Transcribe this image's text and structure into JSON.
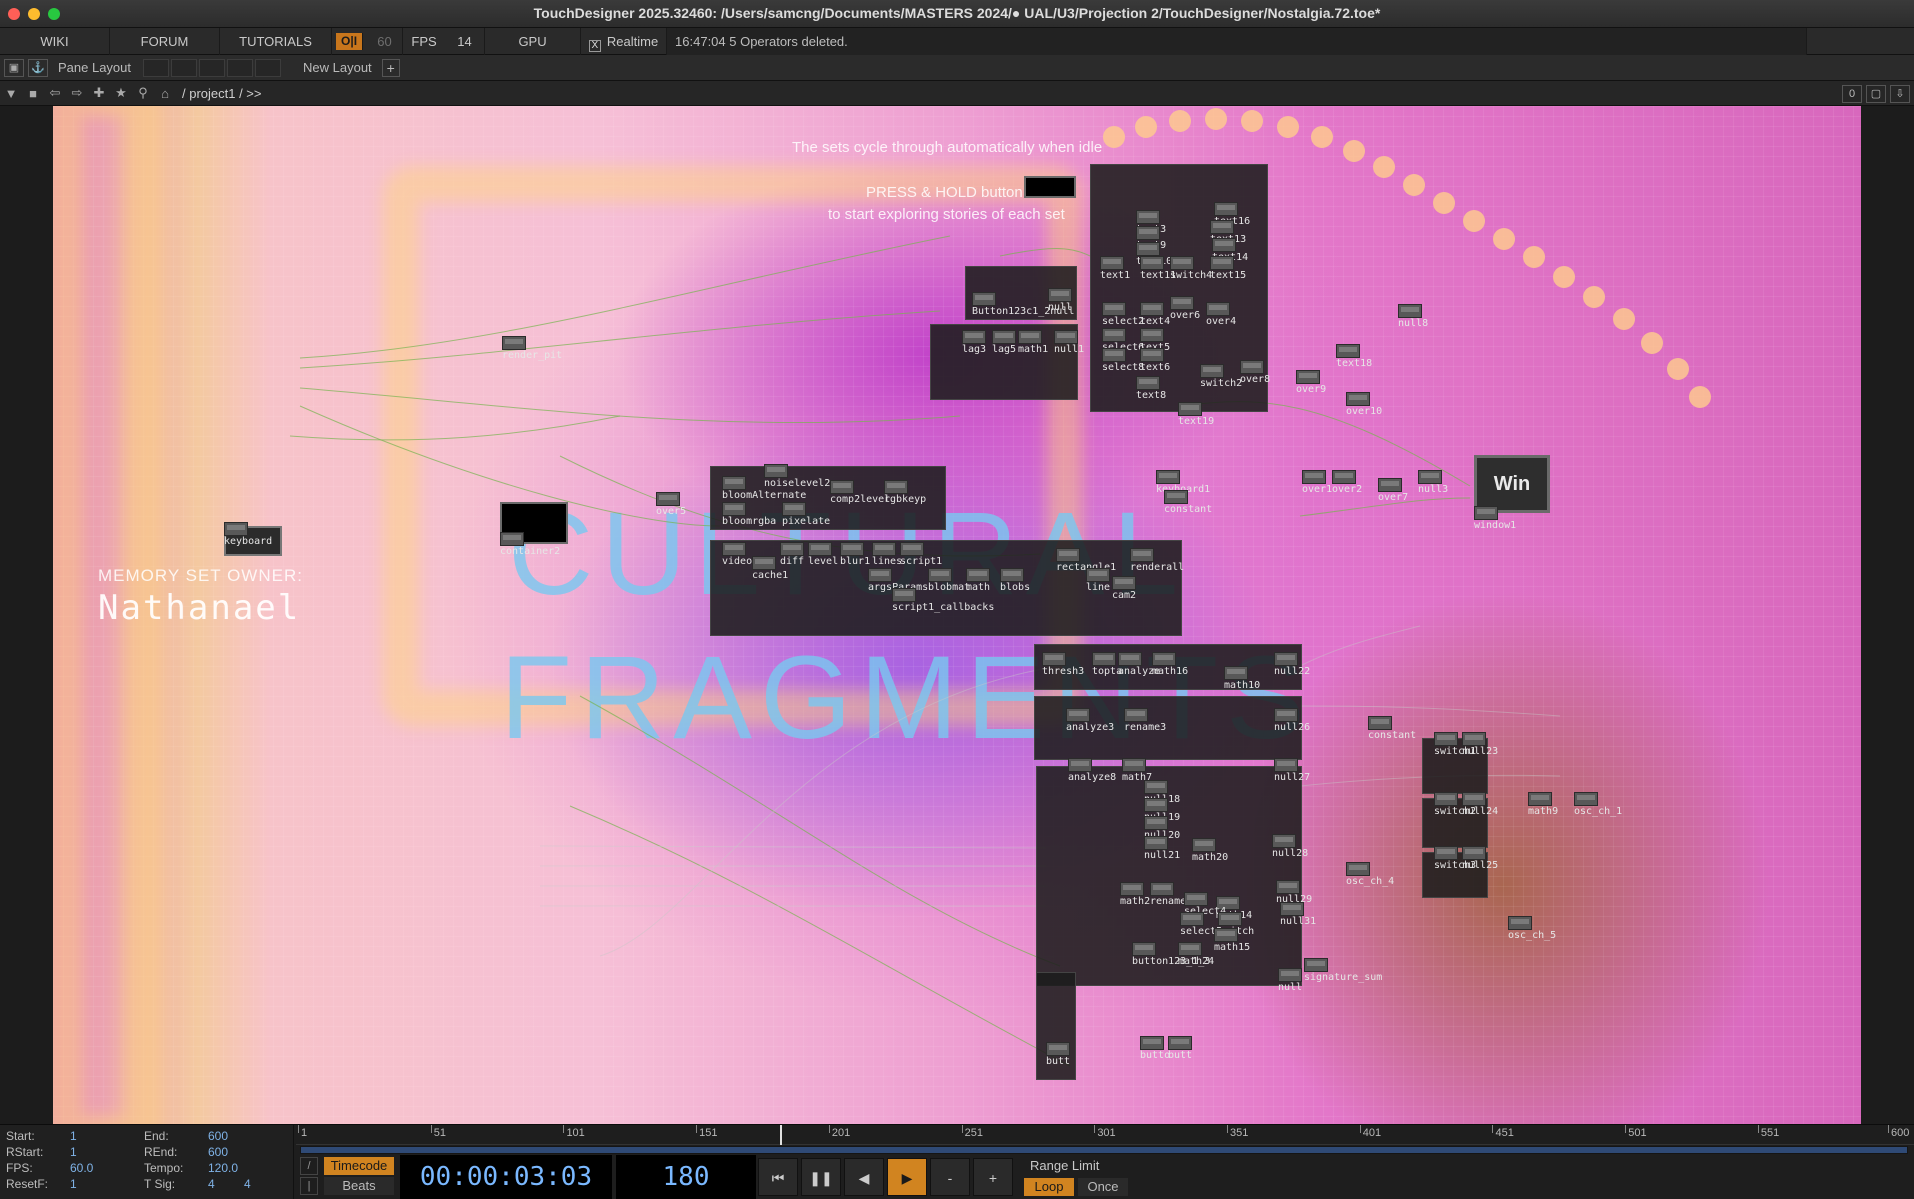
{
  "window": {
    "title": "TouchDesigner 2025.32460: /Users/samcng/Documents/MASTERS 2024/● UAL/U3/Projection 2/TouchDesigner/Nostalgia.72.toe*"
  },
  "menubar": {
    "wiki": "WIKI",
    "forum": "FORUM",
    "tutorials": "TUTORIALS",
    "oi": "O|I",
    "cook_rate": "60",
    "fps_label": "FPS",
    "fps_value": "14",
    "gpu": "GPU",
    "realtime_check": "X",
    "realtime": "Realtime",
    "status": "16:47:04 5 Operators deleted."
  },
  "panebar": {
    "pane_layout": "Pane Layout",
    "new_layout": "New Layout",
    "plus": "+"
  },
  "pathbar": {
    "path": "/ project1 / >>",
    "right_count": "0"
  },
  "network": {
    "hint_top": "The sets cycle through automatically when idle",
    "hint_press": "PRESS & HOLD button",
    "hint_press2": "to start exploring stories of each set",
    "title_line1": "CULTURAL",
    "title_line2": "FRAGMENTS",
    "memory_label": "MEMORY SET OWNER:",
    "memory_name": "Nathanael",
    "win_label": "Win",
    "operators": [
      {
        "label": "render_pit"
      },
      {
        "label": "keyboard"
      },
      {
        "label": "container2"
      },
      {
        "label": "over5"
      },
      {
        "label": "bloomAlternate"
      },
      {
        "label": "noiselevel2"
      },
      {
        "label": "comp2level"
      },
      {
        "label": "rgbkeyp"
      },
      {
        "label": "bloomrgba"
      },
      {
        "label": "pixelate"
      },
      {
        "label": "video"
      },
      {
        "label": "cache1"
      },
      {
        "label": "diff"
      },
      {
        "label": "level"
      },
      {
        "label": "blur1"
      },
      {
        "label": "lines"
      },
      {
        "label": "script1"
      },
      {
        "label": "argsParams"
      },
      {
        "label": "blobmat"
      },
      {
        "label": "math"
      },
      {
        "label": "blobs"
      },
      {
        "label": "script1_callbacks"
      },
      {
        "label": "rectangle1"
      },
      {
        "label": "renderall"
      },
      {
        "label": "line"
      },
      {
        "label": "cam2"
      },
      {
        "label": "Button123c1_2null"
      },
      {
        "label": "null"
      },
      {
        "label": "lag3"
      },
      {
        "label": "lag5"
      },
      {
        "label": "math1"
      },
      {
        "label": "null1"
      },
      {
        "label": "text3"
      },
      {
        "label": "text9"
      },
      {
        "label": "text10"
      },
      {
        "label": "text16"
      },
      {
        "label": "text13"
      },
      {
        "label": "text14"
      },
      {
        "label": "text1"
      },
      {
        "label": "text11"
      },
      {
        "label": "switch4"
      },
      {
        "label": "text15"
      },
      {
        "label": "select2"
      },
      {
        "label": "text4"
      },
      {
        "label": "over6"
      },
      {
        "label": "over4"
      },
      {
        "label": "select6"
      },
      {
        "label": "text5"
      },
      {
        "label": "select8"
      },
      {
        "label": "text6"
      },
      {
        "label": "switch2"
      },
      {
        "label": "over8"
      },
      {
        "label": "text8"
      },
      {
        "label": "text19"
      },
      {
        "label": "over9"
      },
      {
        "label": "over10"
      },
      {
        "label": "text18"
      },
      {
        "label": "null8"
      },
      {
        "label": "keyboard1"
      },
      {
        "label": "constant"
      },
      {
        "label": "over1"
      },
      {
        "label": "over2"
      },
      {
        "label": "over7"
      },
      {
        "label": "null3"
      },
      {
        "label": "window1"
      },
      {
        "label": "thresh3"
      },
      {
        "label": "topta"
      },
      {
        "label": "analyze"
      },
      {
        "label": "math16"
      },
      {
        "label": "null22"
      },
      {
        "label": "math10"
      },
      {
        "label": "analyze3"
      },
      {
        "label": "rename3"
      },
      {
        "label": "null26"
      },
      {
        "label": "analyze8"
      },
      {
        "label": "math7"
      },
      {
        "label": "null27"
      },
      {
        "label": "null18"
      },
      {
        "label": "null19"
      },
      {
        "label": "null20"
      },
      {
        "label": "null21"
      },
      {
        "label": "math20"
      },
      {
        "label": "null28"
      },
      {
        "label": "null29"
      },
      {
        "label": "math2"
      },
      {
        "label": "rename"
      },
      {
        "label": "math14"
      },
      {
        "label": "select4"
      },
      {
        "label": "switch"
      },
      {
        "label": "select5"
      },
      {
        "label": "math15"
      },
      {
        "label": "null31"
      },
      {
        "label": "button123_1_3"
      },
      {
        "label": "math24"
      },
      {
        "label": "null"
      },
      {
        "label": "signature_sum"
      },
      {
        "label": "constant"
      },
      {
        "label": "switch1"
      },
      {
        "label": "null23"
      },
      {
        "label": "switch2"
      },
      {
        "label": "null24"
      },
      {
        "label": "math9"
      },
      {
        "label": "osc_ch_1"
      },
      {
        "label": "switch3"
      },
      {
        "label": "null25"
      },
      {
        "label": "osc_ch_4"
      },
      {
        "label": "osc_ch_5"
      },
      {
        "label": "butt"
      },
      {
        "label": "butto"
      },
      {
        "label": "butt"
      }
    ]
  },
  "timeline": {
    "start_label": "Start:",
    "start_value": "1",
    "end_label": "End:",
    "end_value": "600",
    "rstart_label": "RStart:",
    "rstart_value": "1",
    "rend_label": "REnd:",
    "rend_value": "600",
    "fps_label": "FPS:",
    "fps_value": "60.0",
    "tempo_label": "Tempo:",
    "tempo_value": "120.0",
    "resetf_label": "ResetF:",
    "resetf_value": "1",
    "tsig_label": "T Sig:",
    "tsig_value1": "4",
    "tsig_value2": "4",
    "ticks": [
      "1",
      "51",
      "101",
      "151",
      "201",
      "251",
      "301",
      "351",
      "401",
      "451",
      "501",
      "551",
      "600"
    ],
    "timecode_btn": "Timecode",
    "beats_btn": "Beats",
    "timecode": "00:00:03:03",
    "frame": "180",
    "range_limit": "Range Limit",
    "loop": "Loop",
    "once": "Once",
    "minus": "-",
    "plus": "+"
  },
  "colors": {
    "accent_orange": "#d18420",
    "timecode_blue": "#7ab8ff"
  }
}
